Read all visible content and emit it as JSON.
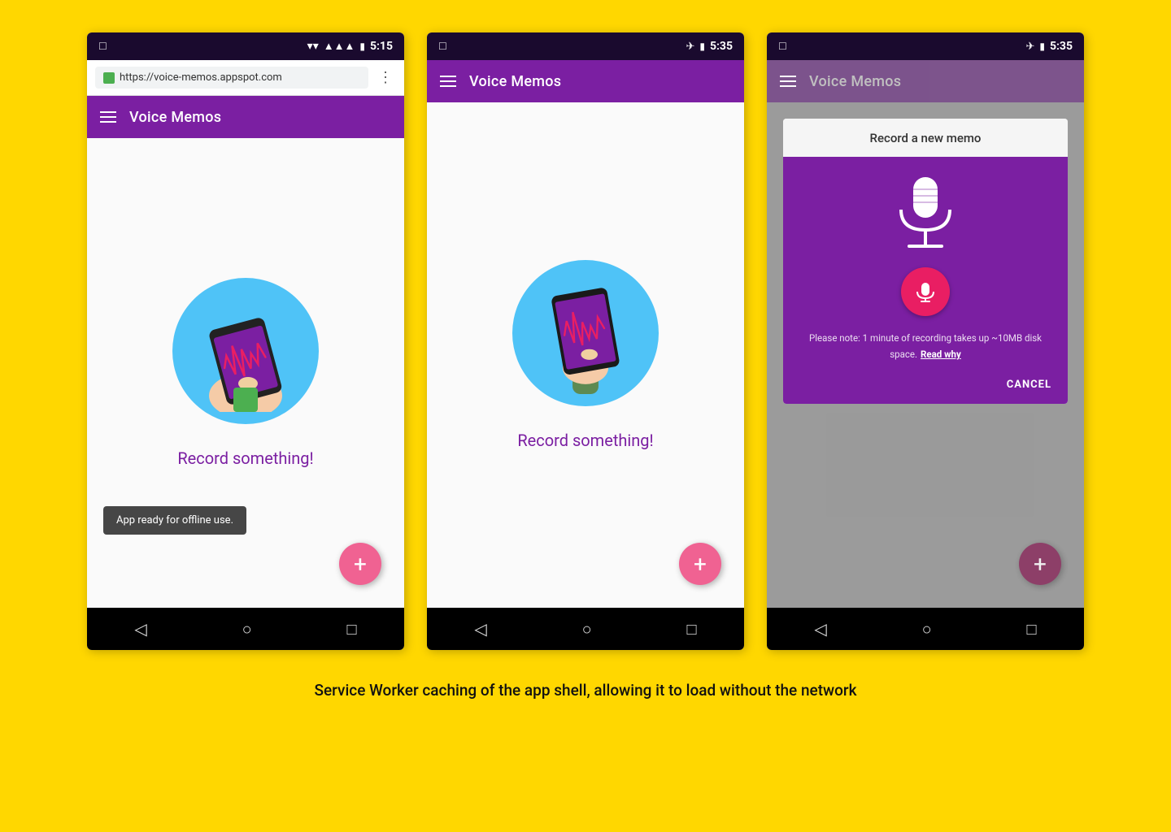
{
  "background_color": "#FFD700",
  "caption": "Service Worker caching of the app shell, allowing it to load without the network",
  "phone1": {
    "status_bar": {
      "time": "5:15",
      "sim_icon": "□",
      "wifi": "▾",
      "signal": "▲",
      "battery": "🔋"
    },
    "browser_bar": {
      "url": "https://voice-memos.appspot.com",
      "lock_label": "lock",
      "dots_label": "⋮"
    },
    "toolbar": {
      "title": "Voice Memos",
      "hamburger_label": "menu"
    },
    "content": {
      "illustration_label": "phone-with-waveform",
      "record_text": "Record something!"
    },
    "toast": {
      "text": "App ready for offline use."
    },
    "fab_label": "+",
    "nav_back": "◁",
    "nav_home": "○",
    "nav_recents": "□"
  },
  "phone2": {
    "status_bar": {
      "time": "5:35",
      "airplane": "✈",
      "battery": "🔋"
    },
    "toolbar": {
      "title": "Voice Memos",
      "hamburger_label": "menu"
    },
    "content": {
      "illustration_label": "phone-with-waveform",
      "record_text": "Record something!"
    },
    "fab_label": "+",
    "nav_back": "◁",
    "nav_home": "○",
    "nav_recents": "□"
  },
  "phone3": {
    "status_bar": {
      "time": "5:35",
      "airplane": "✈",
      "battery": "🔋"
    },
    "toolbar": {
      "title": "Voice Memos",
      "hamburger_label": "menu"
    },
    "dialog": {
      "title": "Record a new memo",
      "mic_label": "microphone",
      "note_text": "Please note: 1 minute of recording takes up ~10MB disk space.",
      "read_why_link": "Read why",
      "cancel_label": "CANCEL"
    },
    "fab_label": "+",
    "nav_back": "◁",
    "nav_home": "○",
    "nav_recents": "□"
  }
}
